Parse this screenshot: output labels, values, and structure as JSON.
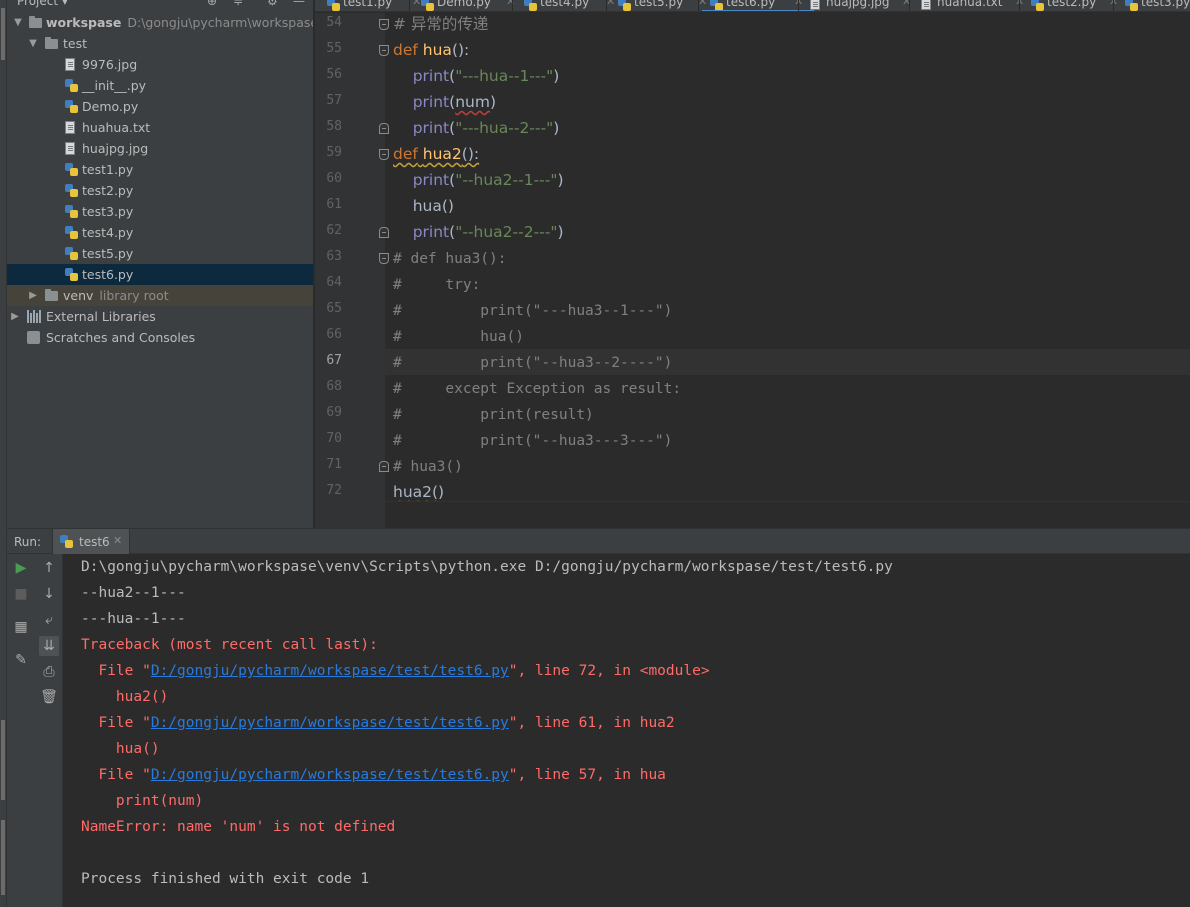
{
  "project": {
    "title": "Project",
    "root": {
      "name": "workspase",
      "path": "D:\\gongju\\pycharm\\workspase"
    },
    "folder": "test",
    "files": [
      {
        "name": "9976.jpg",
        "type": "file"
      },
      {
        "name": "__init__.py",
        "type": "py"
      },
      {
        "name": "Demo.py",
        "type": "py"
      },
      {
        "name": "huahua.txt",
        "type": "file"
      },
      {
        "name": "huajpg.jpg",
        "type": "file"
      },
      {
        "name": "test1.py",
        "type": "py"
      },
      {
        "name": "test2.py",
        "type": "py"
      },
      {
        "name": "test3.py",
        "type": "py"
      },
      {
        "name": "test4.py",
        "type": "py"
      },
      {
        "name": "test5.py",
        "type": "py"
      },
      {
        "name": "test6.py",
        "type": "py",
        "selected": true
      }
    ],
    "venv": {
      "name": "venv",
      "note": "library root"
    },
    "external_libraries": "External Libraries",
    "scratches": "Scratches and Consoles"
  },
  "tabs": [
    {
      "name": "test1.py",
      "type": "py"
    },
    {
      "name": "Demo.py",
      "type": "py"
    },
    {
      "name": "test4.py",
      "type": "py"
    },
    {
      "name": "test5.py",
      "type": "py"
    },
    {
      "name": "test6.py",
      "type": "py",
      "active": true
    },
    {
      "name": "huajpg.jpg",
      "type": "file"
    },
    {
      "name": "huahua.txt",
      "type": "file"
    },
    {
      "name": "test2.py",
      "type": "py"
    },
    {
      "name": "test3.py",
      "type": "py"
    }
  ],
  "editor": {
    "current_line": 67,
    "lines": [
      {
        "n": 54,
        "text": "# 异常的传递"
      },
      {
        "n": 55,
        "text": "def hua():"
      },
      {
        "n": 56,
        "text": "    print(\"---hua--1---\")"
      },
      {
        "n": 57,
        "text": "    print(num)"
      },
      {
        "n": 58,
        "text": "    print(\"---hua--2---\")"
      },
      {
        "n": 59,
        "text": "def hua2():"
      },
      {
        "n": 60,
        "text": "    print(\"--hua2--1---\")"
      },
      {
        "n": 61,
        "text": "    hua()"
      },
      {
        "n": 62,
        "text": "    print(\"--hua2--2---\")"
      },
      {
        "n": 63,
        "text": "# def hua3():"
      },
      {
        "n": 64,
        "text": "#     try:"
      },
      {
        "n": 65,
        "text": "#         print(\"---hua3--1---\")"
      },
      {
        "n": 66,
        "text": "#         hua()"
      },
      {
        "n": 67,
        "text": "#         print(\"--hua3--2----\")"
      },
      {
        "n": 68,
        "text": "#     except Exception as result:"
      },
      {
        "n": 69,
        "text": "#         print(result)"
      },
      {
        "n": 70,
        "text": "#         print(\"--hua3---3---\")"
      },
      {
        "n": 71,
        "text": "# hua3()"
      },
      {
        "n": 72,
        "text": "hua2()"
      }
    ]
  },
  "run": {
    "label": "Run:",
    "tab": "test6",
    "output": [
      {
        "text": "D:\\gongju\\pycharm\\workspase\\venv\\Scripts\\python.exe D:/gongju/pycharm/workspase/test/test6.py",
        "kind": "normal"
      },
      {
        "text": "--hua2--1---",
        "kind": "normal"
      },
      {
        "text": "---hua--1---",
        "kind": "normal"
      },
      {
        "text": "Traceback (most recent call last):",
        "kind": "err"
      },
      {
        "pre": "  File \"",
        "link": "D:/gongju/pycharm/workspase/test/test6.py",
        "post": "\", line 72, in <module>",
        "kind": "err"
      },
      {
        "text": "    hua2()",
        "kind": "err"
      },
      {
        "pre": "  File \"",
        "link": "D:/gongju/pycharm/workspase/test/test6.py",
        "post": "\", line 61, in hua2",
        "kind": "err"
      },
      {
        "text": "    hua()",
        "kind": "err"
      },
      {
        "pre": "  File \"",
        "link": "D:/gongju/pycharm/workspase/test/test6.py",
        "post": "\", line 57, in hua",
        "kind": "err"
      },
      {
        "text": "    print(num)",
        "kind": "err"
      },
      {
        "text": "NameError: name 'num' is not defined",
        "kind": "err"
      },
      {
        "text": "",
        "kind": "normal"
      },
      {
        "text": "Process finished with exit code 1",
        "kind": "normal"
      }
    ]
  },
  "icons": {
    "run": "play-icon",
    "stop": "stop-icon",
    "up": "arrow-up-icon",
    "down": "arrow-down-icon",
    "wrap": "soft-wrap-icon",
    "scroll": "scroll-to-end-icon",
    "print": "print-icon",
    "trash": "trash-icon",
    "pin": "pin-icon",
    "layout": "layout-icon"
  },
  "colors": {
    "keyword": "#cc7832",
    "function": "#ffc66d",
    "builtin": "#8888c6",
    "string": "#6a8759",
    "comment": "#808080",
    "error": "#ff6b68",
    "link": "#287bde",
    "selection": "#0d293e"
  }
}
